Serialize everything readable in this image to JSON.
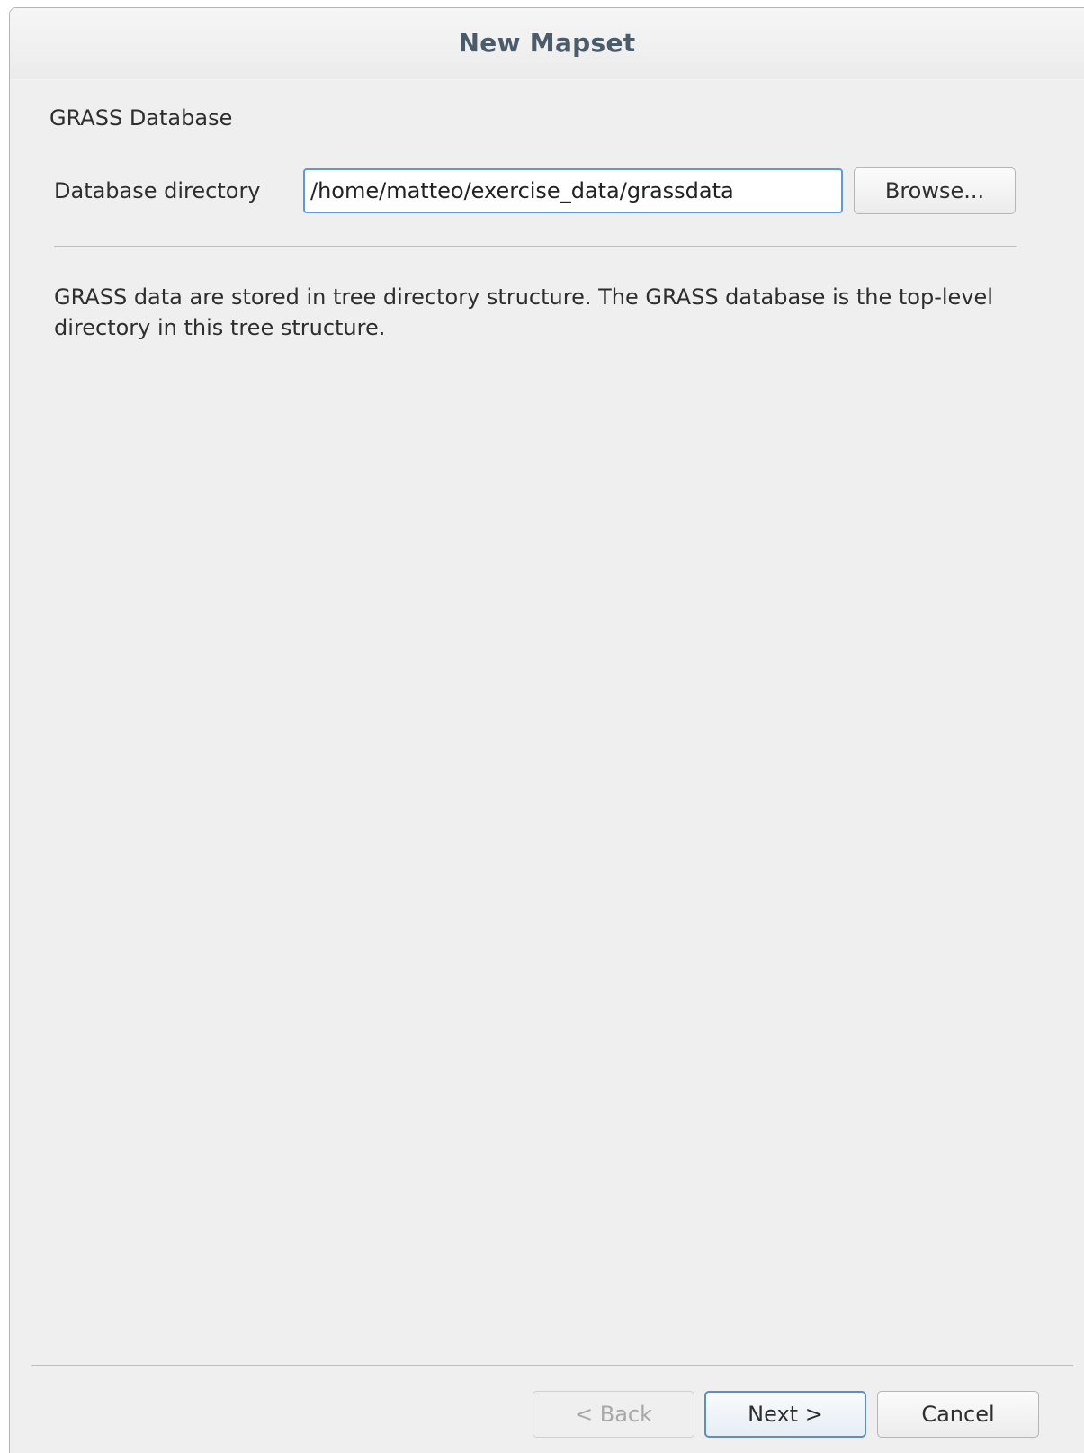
{
  "window": {
    "title": "New Mapset"
  },
  "page": {
    "heading": "GRASS Database",
    "database_label": "Database directory",
    "database_value": "/home/matteo/exercise_data/grassdata",
    "browse_label": "Browse...",
    "description": "GRASS data are stored in tree directory structure. The GRASS database is the top-level directory in this tree structure."
  },
  "footer": {
    "back_label": "< Back",
    "next_label": "Next >",
    "cancel_label": "Cancel",
    "back_enabled": false
  },
  "colors": {
    "title_text": "#4b5b69",
    "focus_border": "#5e9ad6",
    "disabled_text": "#a8a8a8"
  }
}
